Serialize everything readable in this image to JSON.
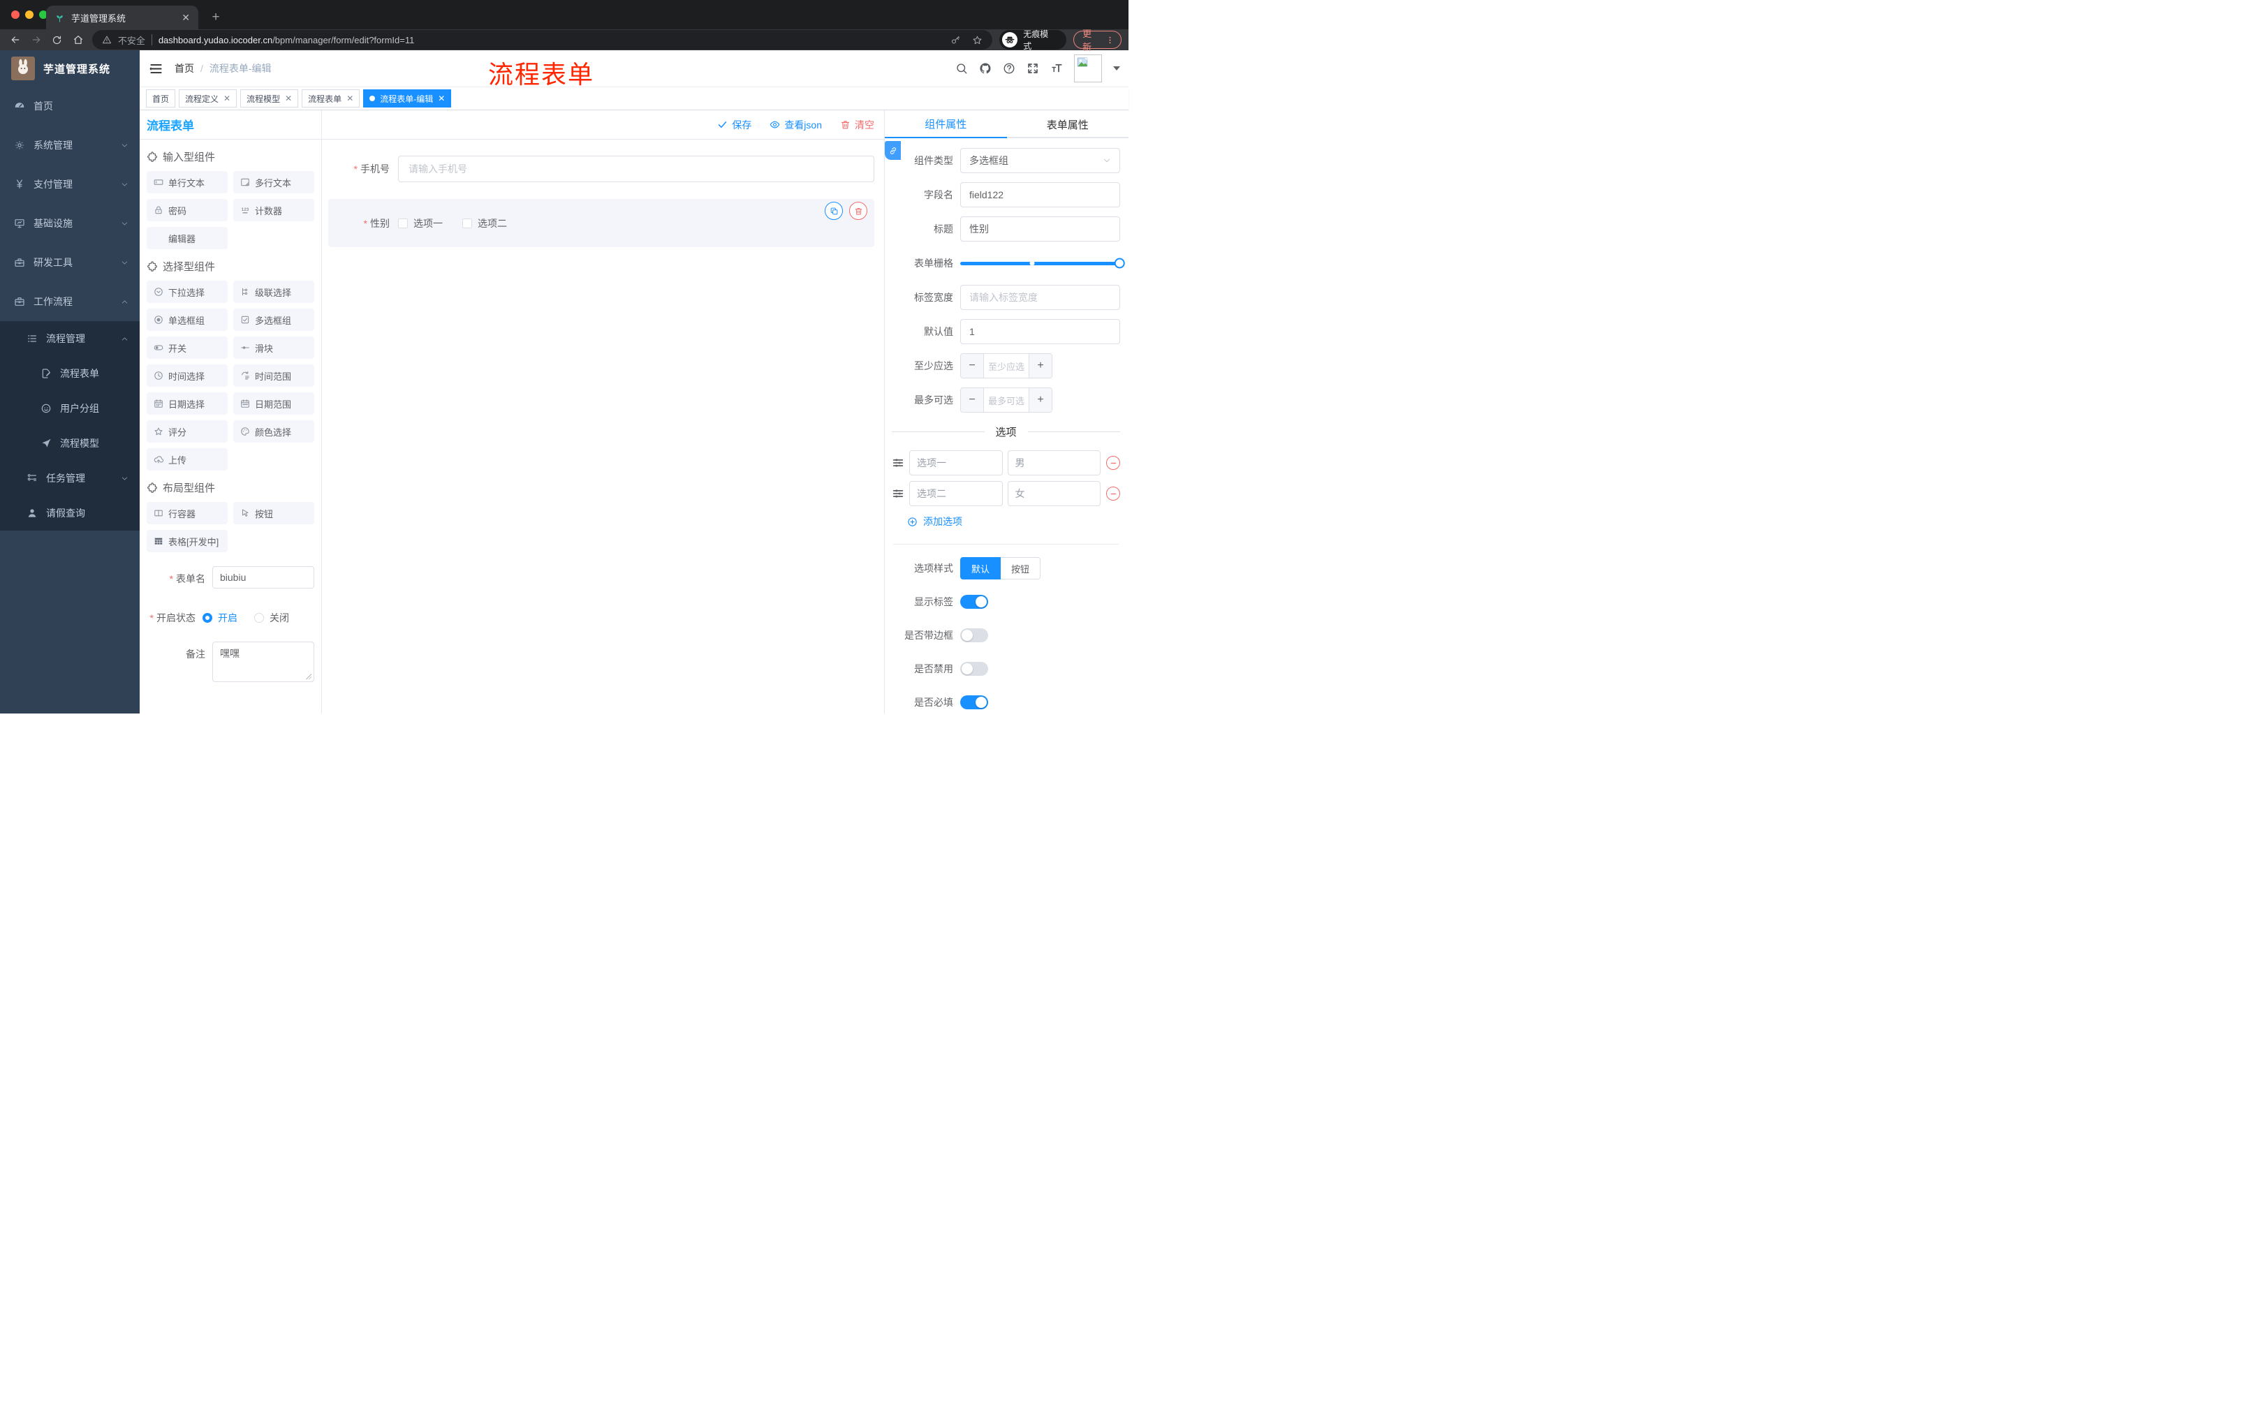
{
  "theme": {
    "accent": "#1890ff",
    "designer_title_blue": "#18a3ff",
    "danger": "#f56c6c",
    "annotation_red": "#ff2600",
    "sidebar_bg": "#304156",
    "submenu_bg": "#1f2d3d"
  },
  "browser": {
    "tab_title": "芋道管理系统",
    "not_secure_label": "不安全",
    "url_domain": "dashboard.yudao.iocoder.cn",
    "url_path": "/bpm/manager/form/edit?formId=11",
    "incognito_label": "无痕模式",
    "update_label": "更新",
    "icons": [
      "sprout-favicon",
      "close-icon",
      "plus-icon",
      "back-icon",
      "forward-icon",
      "reload-icon",
      "home-icon",
      "warning-icon",
      "key-icon",
      "star-icon",
      "incognito-icon",
      "dots-vertical-icon"
    ]
  },
  "annotation": {
    "text": "流程表单"
  },
  "sidebar": {
    "logo_title": "芋道管理系统",
    "items": [
      {
        "icon": "dashboard-icon",
        "label": "首页"
      },
      {
        "icon": "gear-icon",
        "label": "系统管理",
        "chevron": "down"
      },
      {
        "icon": "yen-icon",
        "label": "支付管理",
        "chevron": "down"
      },
      {
        "icon": "monitor-icon",
        "label": "基础设施",
        "chevron": "down"
      },
      {
        "icon": "toolbox-icon",
        "label": "研发工具",
        "chevron": "down"
      },
      {
        "icon": "briefcase-icon",
        "label": "工作流程",
        "chevron": "up"
      },
      {
        "icon": "list-icon",
        "label": "流程管理",
        "chevron": "up",
        "level": 2
      },
      {
        "icon": "form-edit-icon",
        "label": "流程表单",
        "level": 3
      },
      {
        "icon": "face-icon",
        "label": "用户分组",
        "level": 3
      },
      {
        "icon": "send-icon",
        "label": "流程模型",
        "level": 3
      },
      {
        "icon": "tree-icon",
        "label": "任务管理",
        "chevron": "down",
        "level": 2
      },
      {
        "icon": "user-icon",
        "label": "请假查询",
        "level": 2
      }
    ]
  },
  "header": {
    "breadcrumb": {
      "home": "首页",
      "separator": "/",
      "current": "流程表单-编辑"
    },
    "icons": [
      "hamburger-icon",
      "search-icon",
      "github-icon",
      "help-icon",
      "fullscreen-icon",
      "text-size-icon",
      "avatar",
      "caret-down-icon"
    ]
  },
  "tags_view": {
    "tabs": [
      {
        "label": "首页",
        "closable": false,
        "active": false
      },
      {
        "label": "流程定义",
        "closable": true,
        "active": false
      },
      {
        "label": "流程模型",
        "closable": true,
        "active": false
      },
      {
        "label": "流程表单",
        "closable": true,
        "active": false
      },
      {
        "label": "流程表单-编辑",
        "closable": true,
        "active": true
      }
    ]
  },
  "designer": {
    "title": "流程表单",
    "toolbar": {
      "save": "保存",
      "view_json": "查看json",
      "clear": "清空"
    },
    "palette": {
      "sections": [
        {
          "title": "输入型组件",
          "items": [
            {
              "icon": "input-icon",
              "label": "单行文本"
            },
            {
              "icon": "textarea-icon",
              "label": "多行文本"
            },
            {
              "icon": "password-icon",
              "label": "密码"
            },
            {
              "icon": "counter-icon",
              "label": "计数器"
            },
            {
              "icon": "editor-icon",
              "label": "编辑器"
            }
          ]
        },
        {
          "title": "选择型组件",
          "items": [
            {
              "icon": "select-icon",
              "label": "下拉选择"
            },
            {
              "icon": "cascader-icon",
              "label": "级联选择"
            },
            {
              "icon": "radio-icon",
              "label": "单选框组"
            },
            {
              "icon": "checkbox-icon",
              "label": "多选框组"
            },
            {
              "icon": "switch-icon",
              "label": "开关"
            },
            {
              "icon": "slider-icon",
              "label": "滑块"
            },
            {
              "icon": "time-icon",
              "label": "时间选择"
            },
            {
              "icon": "time-range-icon",
              "label": "时间范围"
            },
            {
              "icon": "date-icon",
              "label": "日期选择"
            },
            {
              "icon": "date-range-icon",
              "label": "日期范围"
            },
            {
              "icon": "rate-icon",
              "label": "评分"
            },
            {
              "icon": "color-icon",
              "label": "颜色选择"
            },
            {
              "icon": "upload-icon",
              "label": "上传"
            }
          ]
        },
        {
          "title": "布局型组件",
          "items": [
            {
              "icon": "row-icon",
              "label": "行容器"
            },
            {
              "icon": "button-icon",
              "label": "按钮"
            },
            {
              "icon": "table-icon",
              "label": "表格[开发中]"
            }
          ]
        }
      ]
    },
    "form": {
      "name_label": "表单名",
      "name_value": "biubiu",
      "status_label": "开启状态",
      "status_on": "开启",
      "status_off": "关闭",
      "remark_label": "备注",
      "remark_value": "嘿嘿"
    },
    "canvas": {
      "phone": {
        "label": "手机号",
        "placeholder": "请输入手机号"
      },
      "gender": {
        "label": "性别",
        "options": [
          "选项一",
          "选项二"
        ]
      }
    },
    "props": {
      "tab_component": "组件属性",
      "tab_form": "表单属性",
      "component_type_label": "组件类型",
      "component_type_value": "多选框组",
      "field_name_label": "字段名",
      "field_name_value": "field122",
      "title_label": "标题",
      "title_value": "性别",
      "grid_label": "表单栅格",
      "grid_stop_percent": 45,
      "grid_value_percent": 100,
      "label_width_label": "标签宽度",
      "label_width_placeholder": "请输入标签宽度",
      "default_label": "默认值",
      "default_value": "1",
      "min_label": "至少应选",
      "min_placeholder": "至少应选",
      "max_label": "最多可选",
      "max_placeholder": "最多可选",
      "options_title": "选项",
      "options": [
        {
          "label": "选项一",
          "value": "男"
        },
        {
          "label": "选项二",
          "value": "女"
        }
      ],
      "add_option": "添加选项",
      "option_style_label": "选项样式",
      "style_default": "默认",
      "style_button": "按钮",
      "switches": [
        {
          "label": "显示标签",
          "on": true
        },
        {
          "label": "是否带边框",
          "on": false
        },
        {
          "label": "是否禁用",
          "on": false
        },
        {
          "label": "是否必填",
          "on": true
        }
      ]
    }
  }
}
